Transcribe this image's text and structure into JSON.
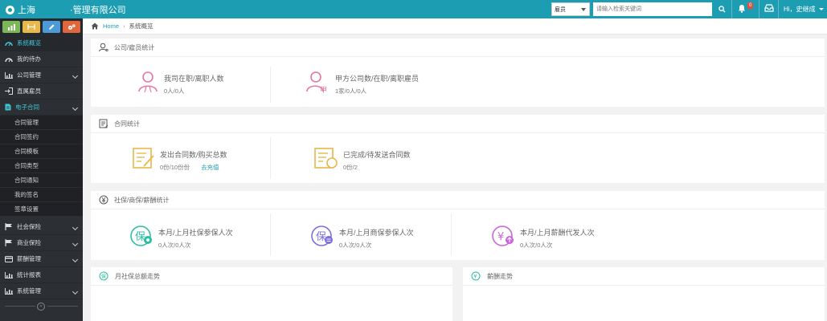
{
  "header": {
    "logo_text": "上海",
    "company": "·管理有限公司",
    "role_select": "雇员",
    "search_placeholder": "请输入检索关键词",
    "notification_count": "0",
    "user_name": "Hi，史继成"
  },
  "sidebar": {
    "items": [
      {
        "label": "系统概览"
      },
      {
        "label": "我的待办"
      },
      {
        "label": "公司管理"
      },
      {
        "label": "直属雇员"
      },
      {
        "label": "电子合同"
      },
      {
        "label": "社会保险"
      },
      {
        "label": "商业保险"
      },
      {
        "label": "薪酬管理"
      },
      {
        "label": "统计报表"
      },
      {
        "label": "系统管理"
      }
    ],
    "sub_items": [
      "合同管理",
      "合同签约",
      "合同模板",
      "合同类型",
      "合同通知",
      "我的签名",
      "签章设置"
    ]
  },
  "breadcrumb": {
    "home": "Home",
    "current": "系统概览"
  },
  "panels": {
    "employee": {
      "title": "公司/雇员统计",
      "stats": [
        {
          "title": "我司在职/离职人数",
          "value": "0人/0人"
        },
        {
          "title": "甲方公司数/在职/离职雇员",
          "value": "1家/0人/0人"
        }
      ]
    },
    "contract": {
      "title": "合同统计",
      "stats": [
        {
          "title": "发出合同数/购买总数",
          "value": "0份/10份份",
          "link": "去充值"
        },
        {
          "title": "已完成/待发送合同数",
          "value": "0份/2"
        }
      ]
    },
    "insurance": {
      "title": "社保/商保/薪酬统计",
      "stats": [
        {
          "title": "本月/上月社保参保人次",
          "value": "0人次/0人次"
        },
        {
          "title": "本月/上月商保参保人次",
          "value": "0人次/0人次"
        },
        {
          "title": "本月/上月薪酬代发人次",
          "value": "0人次/0人次"
        }
      ]
    },
    "social_trend": {
      "title": "月社保总额走势"
    },
    "salary_trend": {
      "title": "薪酬走势"
    }
  },
  "colors": {
    "topbar": "#1d9db2",
    "sidebar": "#2c2f34",
    "pink": "#e9779b",
    "yellow": "#e8b84a",
    "teal": "#2bbfa4",
    "purple": "#7b6fe0",
    "magenta": "#c966d9"
  }
}
